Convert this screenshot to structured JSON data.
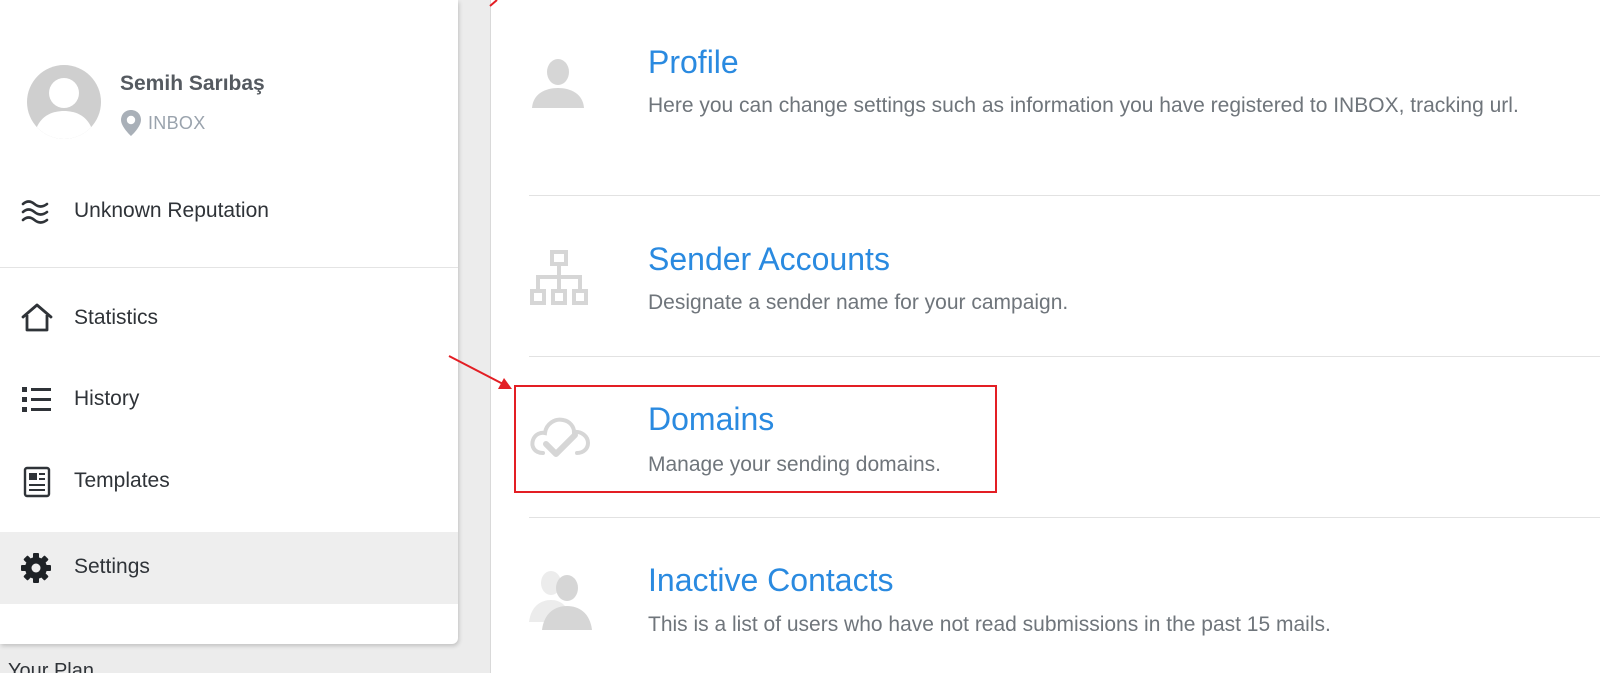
{
  "sidebar": {
    "user": {
      "name": "Semih Sarıbaş",
      "location": "INBOX"
    },
    "reputation": {
      "label": "Unknown Reputation",
      "icon": "waves-icon"
    },
    "nav": [
      {
        "label": "Statistics",
        "icon": "home-icon",
        "active": false
      },
      {
        "label": "History",
        "icon": "list-icon",
        "active": false
      },
      {
        "label": "Templates",
        "icon": "newspaper-icon",
        "active": false
      },
      {
        "label": "Settings",
        "icon": "gear-icon",
        "active": true
      }
    ],
    "footer_partial": "Your Plan"
  },
  "settings": {
    "sections": [
      {
        "title": "Profile",
        "description": "Here you can change settings such as information you have registered to INBOX, tracking url.",
        "icon": "user-icon"
      },
      {
        "title": "Sender Accounts",
        "description": "Designate a sender name for your campaign.",
        "icon": "sitemap-icon"
      },
      {
        "title": "Domains",
        "description": "Manage your sending domains.",
        "icon": "cloud-check-icon",
        "highlighted": true
      },
      {
        "title": "Inactive Contacts",
        "description": "This is a list of users who have not read submissions in the past 15 mails.",
        "icon": "users-icon"
      }
    ]
  },
  "colors": {
    "link": "#2a8ae0",
    "annotation": "#e31e24",
    "active_bg": "#eeeeee",
    "icon_gray": "#d6d6d6"
  }
}
